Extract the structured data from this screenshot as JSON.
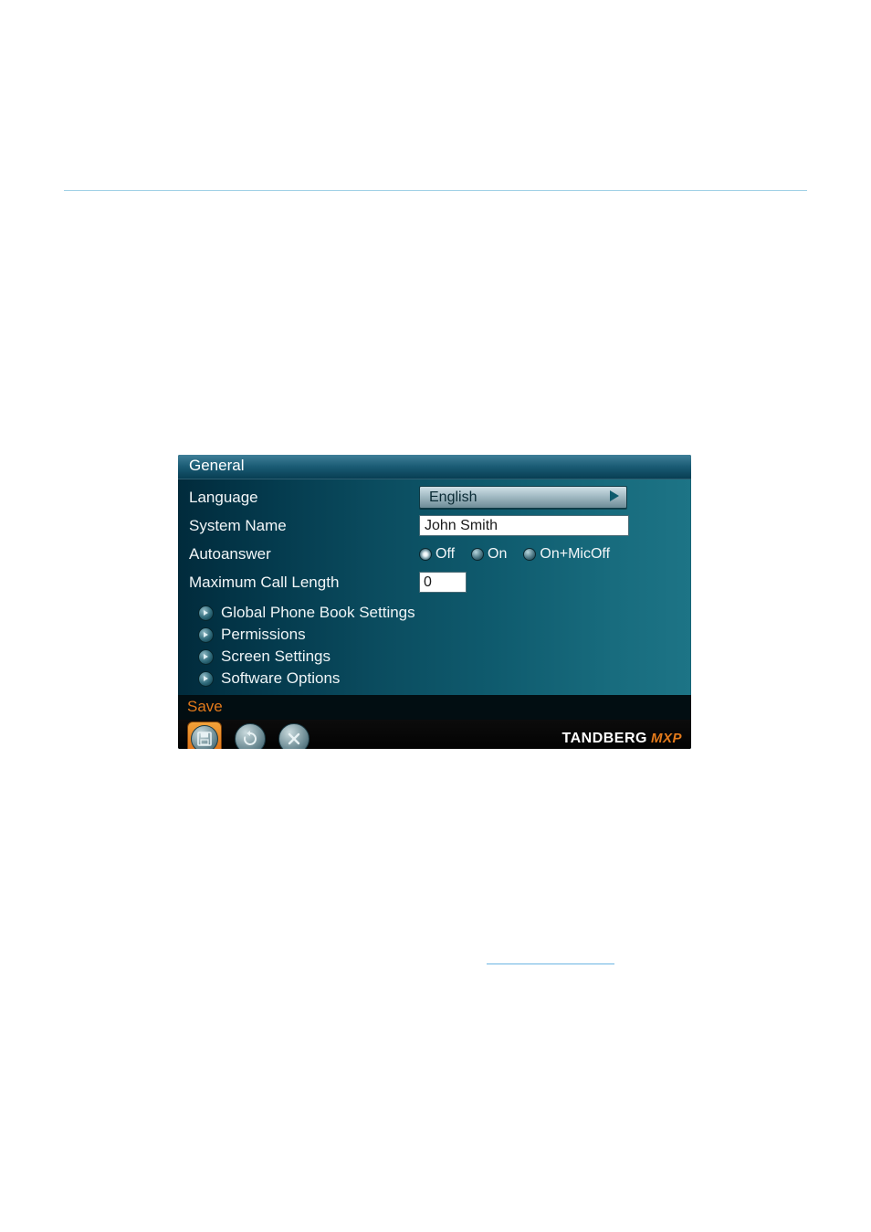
{
  "header": {
    "title": "General"
  },
  "fields": {
    "language": {
      "label": "Language",
      "value": "English"
    },
    "system_name": {
      "label": "System Name",
      "value": "John Smith"
    },
    "autoanswer": {
      "label": "Autoanswer",
      "options": {
        "off": "Off",
        "on": "On",
        "onmicoff": "On+MicOff"
      },
      "selected": "off"
    },
    "max_call_length": {
      "label": "Maximum Call Length",
      "value": "0"
    }
  },
  "sublinks": {
    "global_phone_book": "Global Phone Book Settings",
    "permissions": "Permissions",
    "screen_settings": "Screen Settings",
    "software_options": "Software Options"
  },
  "save_label": "Save",
  "brand": {
    "name": "TANDBERG",
    "suffix": "MXP"
  },
  "icons": {
    "save": "save-icon",
    "refresh": "refresh-icon",
    "close": "close-icon",
    "play": "play-icon",
    "bullet": "bullet-play-icon"
  }
}
